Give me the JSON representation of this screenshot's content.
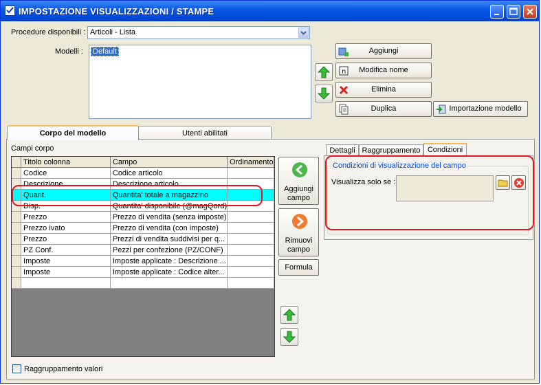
{
  "window": {
    "title": "IMPOSTAZIONE VISUALIZZAZIONI / STAMPE"
  },
  "procedure": {
    "label": "Procedure disponibili :",
    "value": "Articoli - Lista"
  },
  "modelli": {
    "label": "Modelli :",
    "items": [
      "Default"
    ]
  },
  "buttons": {
    "aggiungi": "Aggiungi",
    "modifica_nome": "Modifica nome",
    "elimina": "Elimina",
    "duplica": "Duplica",
    "importazione_modello": "Importazione modello"
  },
  "tabs": [
    "Corpo del modello",
    "Utenti abilitati"
  ],
  "campi_corpo": {
    "label": "Campi corpo",
    "columns": [
      "Titolo colonna",
      "Campo",
      "Ordinamento"
    ],
    "rows": [
      {
        "titolo": "Codice",
        "campo": "Codice articolo",
        "ordinamento": ""
      },
      {
        "titolo": "Descrizione",
        "campo": "Descrizione articolo",
        "ordinamento": ""
      },
      {
        "titolo": "Quant.",
        "campo": "Quantita' totale a magazzino",
        "ordinamento": ""
      },
      {
        "titolo": "Disp.",
        "campo": "Quantita' disponibile (@magQord)",
        "ordinamento": ""
      },
      {
        "titolo": "Prezzo",
        "campo": "Prezzo di vendita (senza imposte)",
        "ordinamento": ""
      },
      {
        "titolo": "Prezzo ivato",
        "campo": "Prezzo di vendita (con imposte)",
        "ordinamento": ""
      },
      {
        "titolo": "Prezzo",
        "campo": "Prezzi di vendita suddivisi per q...",
        "ordinamento": ""
      },
      {
        "titolo": "PZ Conf.",
        "campo": "Pezzi per confezione (PZ/CONF)",
        "ordinamento": ""
      },
      {
        "titolo": "Imposte",
        "campo": "Imposte applicate : Descrizione ...",
        "ordinamento": ""
      },
      {
        "titolo": "Imposte",
        "campo": "Imposte applicate : Codice alter...",
        "ordinamento": ""
      },
      {
        "titolo": "",
        "campo": "",
        "ordinamento": ""
      }
    ]
  },
  "field_buttons": {
    "aggiungi_campo": "Aggiungi campo",
    "rimuovi_campo": "Rimuovi campo",
    "formula": "Formula"
  },
  "right_tabs": [
    "Dettagli",
    "Raggruppamento",
    "Condizioni"
  ],
  "condizioni": {
    "group_title": "Condizioni di visualizzazione del campo",
    "label": "Visualizza solo se :",
    "value": ""
  },
  "raggruppamento_valori": {
    "label": "Raggruppamento valori",
    "checked": false
  },
  "colors": {
    "highlight_row": "#00ffff",
    "annotation": "#e0141e",
    "titlebar": "#0a5ae8",
    "group_title": "#0046d5"
  }
}
